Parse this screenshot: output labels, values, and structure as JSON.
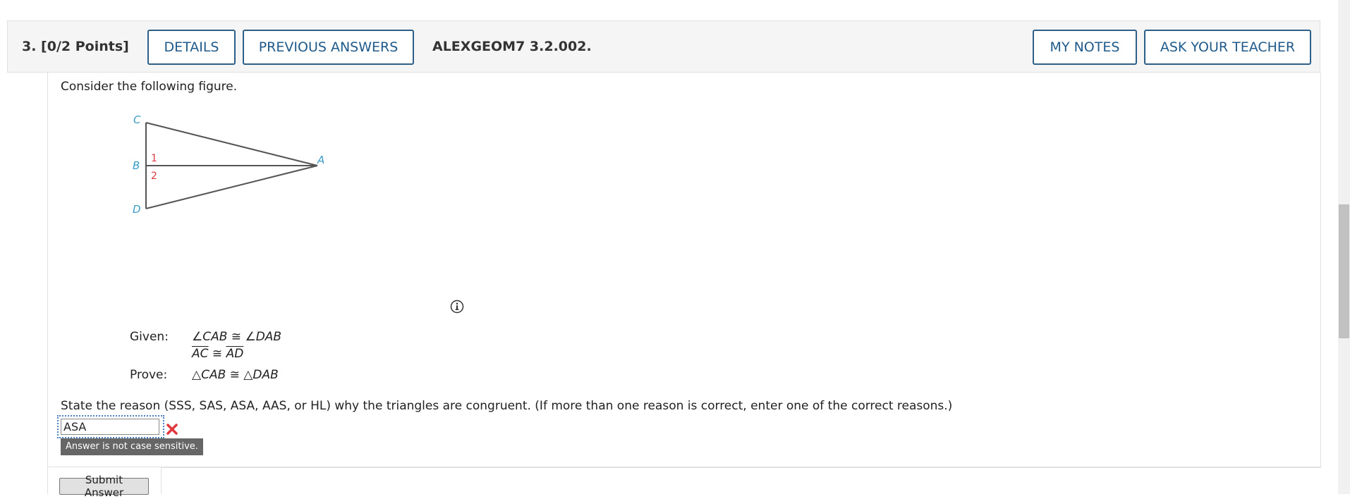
{
  "header": {
    "question_label": "3. [0/2 Points]",
    "details_label": "DETAILS",
    "previous_answers_label": "PREVIOUS ANSWERS",
    "question_code": "ALEXGEOM7 3.2.002.",
    "my_notes_label": "MY NOTES",
    "ask_teacher_label": "ASK YOUR TEACHER"
  },
  "question": {
    "intro": "Consider the following figure.",
    "figure_labels": {
      "c": "C",
      "b": "B",
      "d": "D",
      "a": "A",
      "angle1": "1",
      "angle2": "2"
    },
    "given_label": "Given:",
    "given_line1": "∠CAB ≅ ∠DAB",
    "given_line2_left": "AC",
    "given_line2_op": " ≅ ",
    "given_line2_right": "AD",
    "prove_label": "Prove:",
    "prove_text": "△CAB ≅ △DAB",
    "instruction": "State the reason (SSS, SAS, ASA, AAS, or HL) why the triangles are congruent. (If more than one reason is correct, enter one of the correct reasons.)"
  },
  "answer": {
    "value": "ASA",
    "status": "incorrect",
    "hint": "Answer is not case sensitive."
  },
  "submit_label": "Submit Answer",
  "colors": {
    "accent": "#1f5a8a",
    "figure_vertex": "#3a9cc6",
    "figure_angle": "#e0383e",
    "incorrect": "#e0383e"
  },
  "icons": [
    "info-icon",
    "incorrect-x-icon"
  ]
}
